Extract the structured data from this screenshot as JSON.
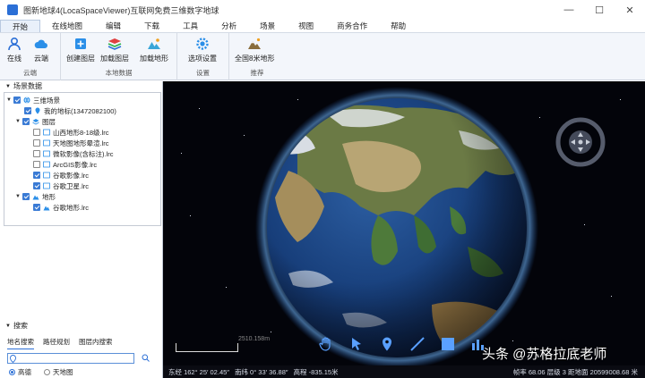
{
  "window": {
    "title": "图新地球4(LocaSpaceViewer)互联网免费三维数字地球",
    "minimize": "—",
    "maximize": "☐",
    "close": "✕"
  },
  "menu": [
    "开始",
    "在线地图",
    "编辑",
    "下载",
    "工具",
    "分析",
    "场景",
    "视图",
    "商务合作",
    "帮助"
  ],
  "ribbon": {
    "groups": [
      {
        "label": "云端",
        "buttons": [
          "在线",
          "云端"
        ]
      },
      {
        "label": "本地数据",
        "buttons": [
          "创建图层",
          "加载图层",
          "加载地形"
        ]
      },
      {
        "label": "设置",
        "buttons": [
          "选项设置"
        ]
      },
      {
        "label": "推荐",
        "buttons": [
          "全国8米地形"
        ]
      }
    ]
  },
  "scene_panel": {
    "title": "场景数据",
    "root": "三维场景",
    "my_places": "我的地标(13472082100)",
    "layers": "图层",
    "layer_items": [
      {
        "label": "山西地形8-18级.lrc",
        "checked": false
      },
      {
        "label": "天地图地形晕渲.lrc",
        "checked": false
      },
      {
        "label": "微软影像(含标注).lrc",
        "checked": false
      },
      {
        "label": "ArcGIS影像.lrc",
        "checked": false
      },
      {
        "label": "谷歌影像.lrc",
        "checked": true
      },
      {
        "label": "谷歌卫星.lrc",
        "checked": true
      }
    ],
    "terrain": "地形",
    "terrain_items": [
      {
        "label": "谷歌地形.lrc",
        "checked": true
      }
    ]
  },
  "search_panel": {
    "title": "搜索",
    "tabs": [
      "地名搜索",
      "路径规划",
      "图层内搜索"
    ],
    "input_value": "",
    "sources": [
      "高德",
      "天地图"
    ],
    "selected_source": "高德"
  },
  "viewport": {
    "scale_label": "2510.158m",
    "watermark": "头条 @苏格拉底老师"
  },
  "status": {
    "longitude": "东经 162° 25′ 02.45″",
    "latitude": "南纬 0° 33′ 36.88″",
    "altitude": "高程 -835.15米",
    "right": "帧率 68.06  层级 3  距地面 20599008.68 米"
  },
  "colors": {
    "accent": "#2b6fd6",
    "ribbon_bg": "#f3f6fb",
    "viewport_bg": "#03040a"
  }
}
